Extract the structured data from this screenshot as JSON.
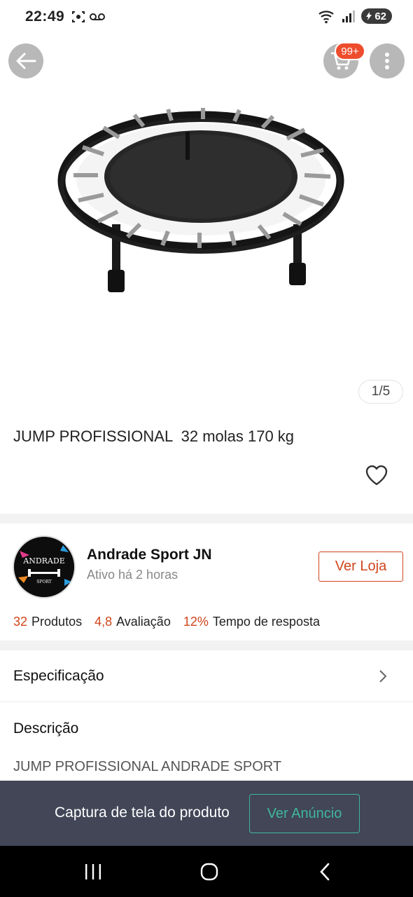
{
  "status_bar": {
    "time": "22:49",
    "battery": "62",
    "sim_indicator": "5"
  },
  "header": {
    "cart_badge": "99+"
  },
  "gallery": {
    "counter": "1/5"
  },
  "product": {
    "title": "JUMP PROFISSIONAL  32 molas 170 kg"
  },
  "shop": {
    "logo_text_top": "ANDRADE",
    "logo_text_bottom": "SPORT",
    "name": "Andrade Sport JN",
    "status": "Ativo há 2 horas",
    "visit_button": "Ver Loja",
    "stats": [
      {
        "value": "32",
        "label": "Produtos"
      },
      {
        "value": "4,8",
        "label": "Avaliação"
      },
      {
        "value": "12%",
        "label": "Tempo de resposta"
      }
    ]
  },
  "sections": {
    "spec_label": "Especificação",
    "desc_label": "Descrição",
    "desc_text": "JUMP PROFISSIONAL ANDRADE SPORT"
  },
  "capture_bar": {
    "text": "Captura de tela do produto",
    "button": "Ver Anúncio"
  },
  "colors": {
    "accent": "#d0451b",
    "badge": "#ee4d2d",
    "teal": "#3fb79b",
    "overlay": "#424657"
  }
}
